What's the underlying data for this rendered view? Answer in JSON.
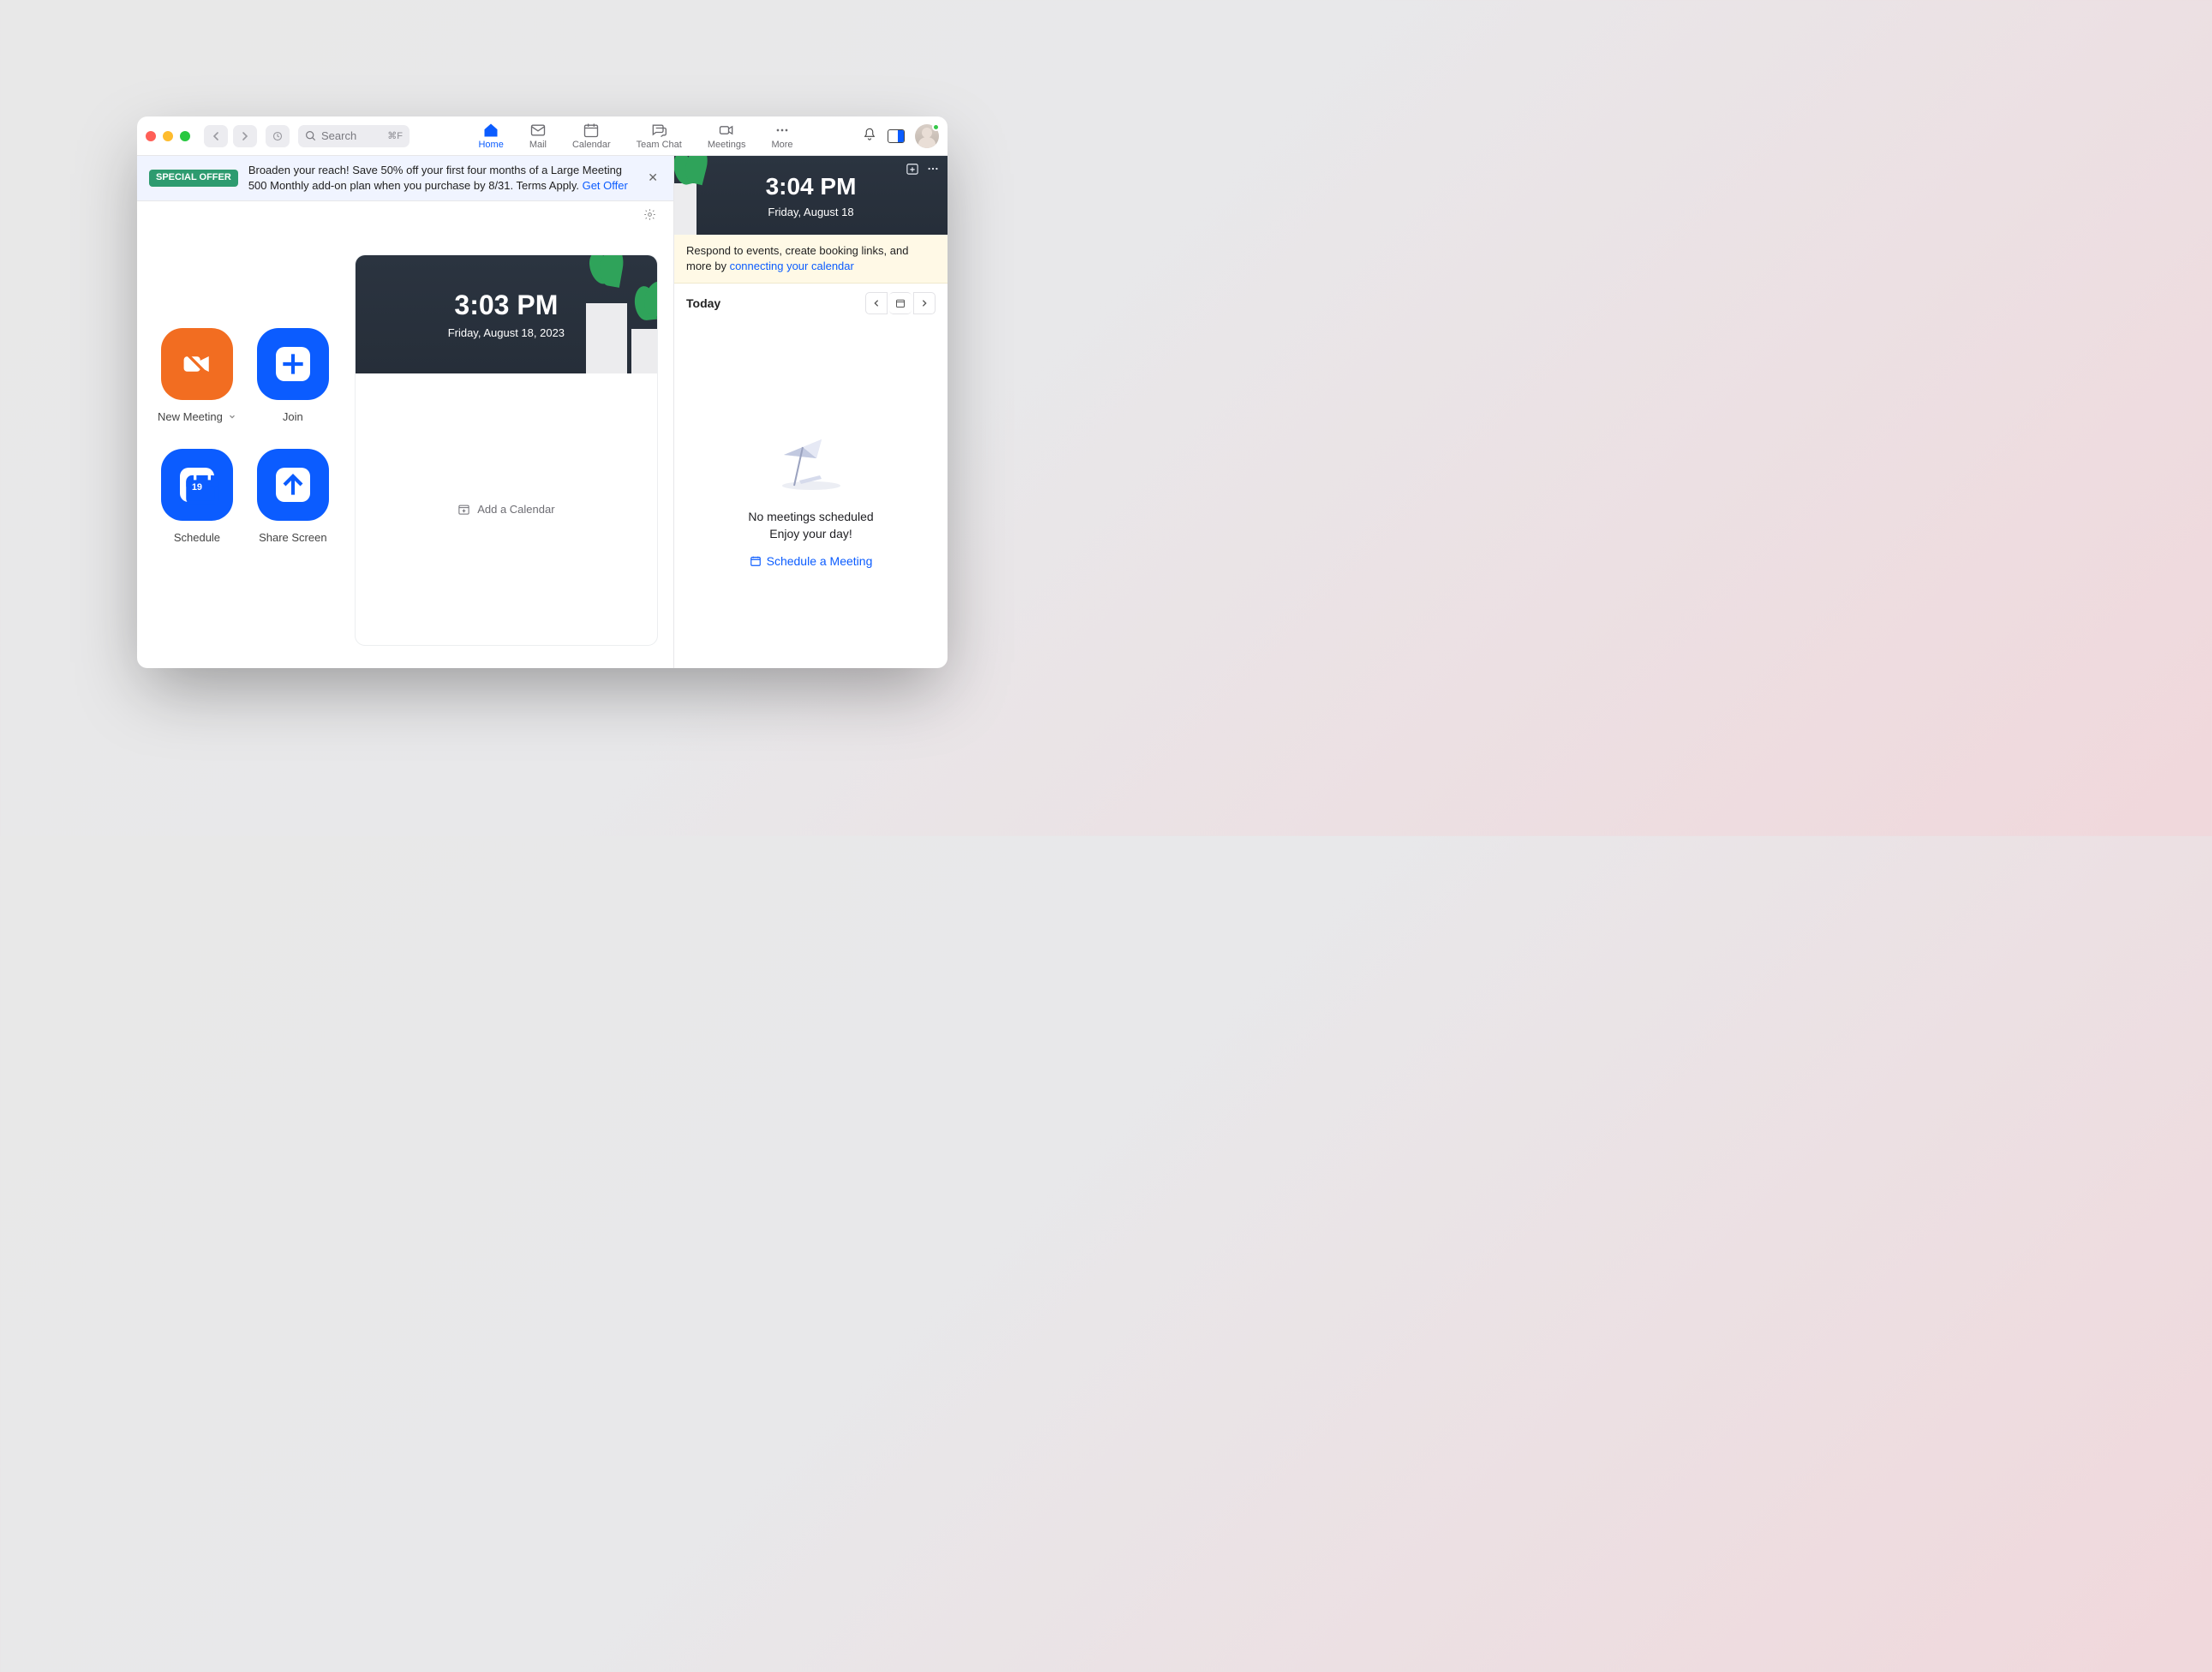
{
  "titlebar": {
    "search_placeholder": "Search",
    "search_shortcut": "⌘F",
    "tabs": [
      {
        "label": "Home",
        "name": "tab-home",
        "active": true
      },
      {
        "label": "Mail",
        "name": "tab-mail",
        "active": false
      },
      {
        "label": "Calendar",
        "name": "tab-calendar",
        "active": false
      },
      {
        "label": "Team Chat",
        "name": "tab-team-chat",
        "active": false
      },
      {
        "label": "Meetings",
        "name": "tab-meetings",
        "active": false
      },
      {
        "label": "More",
        "name": "tab-more",
        "active": false
      }
    ]
  },
  "banner": {
    "badge": "SPECIAL OFFER",
    "text": "Broaden your reach! Save 50% off your first four months of a Large Meeting 500 Monthly add-on plan when you purchase by 8/31. Terms Apply. ",
    "link": "Get Offer"
  },
  "actions": {
    "new_meeting": "New Meeting",
    "join": "Join",
    "schedule": "Schedule",
    "schedule_day": "19",
    "share": "Share Screen"
  },
  "card": {
    "time": "3:03 PM",
    "date": "Friday, August 18, 2023",
    "add_calendar": "Add a Calendar"
  },
  "sidebar": {
    "time": "3:04 PM",
    "date": "Friday, August 18",
    "hint_before": "Respond to events, create booking links, and more by ",
    "hint_link": "connecting your calendar",
    "today": "Today",
    "empty1": "No meetings scheduled",
    "empty2": "Enjoy your day!",
    "schedule_link": "Schedule a Meeting"
  }
}
